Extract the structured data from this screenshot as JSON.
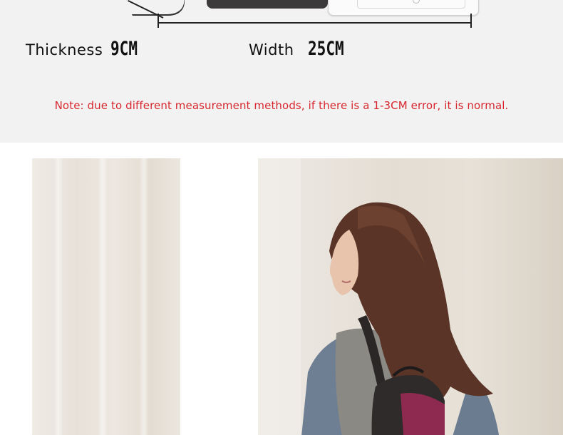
{
  "dimensions": {
    "thickness_label": "Thickness",
    "thickness_value": "9CM",
    "width_label": "Width",
    "width_value": "25CM"
  },
  "note": "Note: due to different measurement methods, if there is a 1-3CM error, it is normal.",
  "colors": {
    "note_text": "#d8282f",
    "panel_background": "#f3f2f2",
    "bag_accent": "#8e2a4f"
  },
  "photos": {
    "left": "curtain-photo",
    "right": "model-wearing-backpack-photo"
  }
}
